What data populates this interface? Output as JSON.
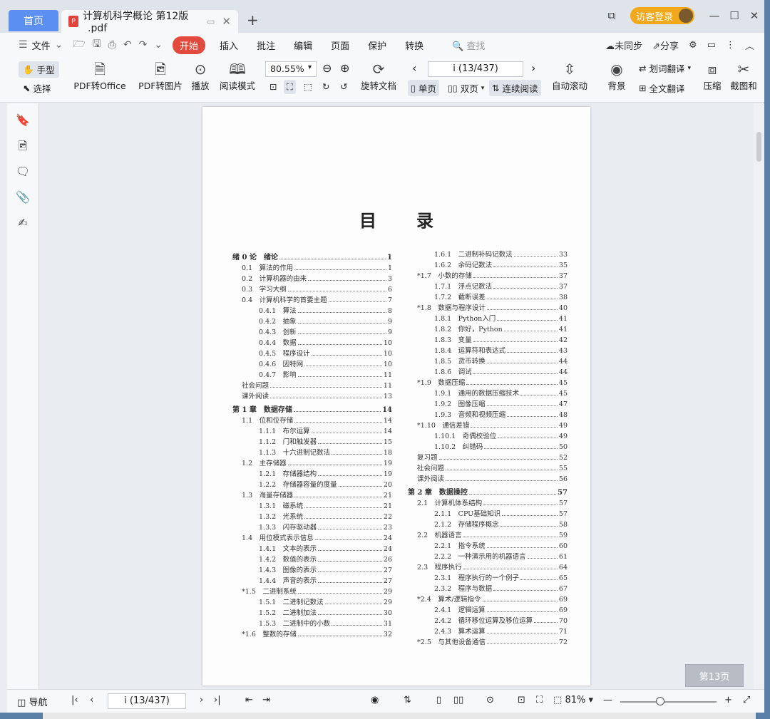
{
  "tabs": {
    "home": "首页",
    "doc": "计算机科学概论 第12版_.pdf",
    "add": "+"
  },
  "window": {
    "login": "访客登录",
    "min": "—",
    "max": "☐",
    "close": "✕",
    "layout_icon": "⧉"
  },
  "menu": {
    "file": "文件",
    "start": "开始",
    "items": [
      "插入",
      "批注",
      "编辑",
      "页面",
      "保护",
      "转换"
    ],
    "search": "查找",
    "sync": "未同步",
    "share": "分享"
  },
  "toolbar": {
    "hand": "手型",
    "select": "选择",
    "pdf_office": "PDF转Office",
    "pdf_img": "PDF转图片",
    "play": "播放",
    "read_mode": "阅读模式",
    "zoom": "80.55%",
    "rotate": "旋转文档",
    "page": "i (13/437)",
    "single": "单页",
    "double": "双页",
    "continuous": "连续阅读",
    "autoscroll": "自动滚动",
    "background": "背景",
    "word_trans": "划词翻译",
    "full_trans": "全文翻译",
    "compress": "压缩",
    "screenshot": "截图和"
  },
  "document": {
    "toc_title": "目录",
    "left": [
      {
        "n": "绪 0 论　绪论",
        "p": "1",
        "lv": "ch"
      },
      {
        "n": "0.1　算法的作用",
        "p": "1",
        "lv": "l1"
      },
      {
        "n": "0.2　计算机器的由来",
        "p": "3",
        "lv": "l1"
      },
      {
        "n": "0.3　学习大纲",
        "p": "6",
        "lv": "l1"
      },
      {
        "n": "0.4　计算机科学的首要主题",
        "p": "7",
        "lv": "l1"
      },
      {
        "n": "0.4.1　算法",
        "p": "8",
        "lv": "l2"
      },
      {
        "n": "0.4.2　抽象",
        "p": "9",
        "lv": "l2"
      },
      {
        "n": "0.4.3　创新",
        "p": "9",
        "lv": "l2"
      },
      {
        "n": "0.4.4　数据",
        "p": "10",
        "lv": "l2"
      },
      {
        "n": "0.4.5　程序设计",
        "p": "10",
        "lv": "l2"
      },
      {
        "n": "0.4.6　因特网",
        "p": "10",
        "lv": "l2"
      },
      {
        "n": "0.4.7　影响",
        "p": "11",
        "lv": "l2"
      },
      {
        "n": "社会问题",
        "p": "11",
        "lv": "l0s"
      },
      {
        "n": "课外阅读",
        "p": "13",
        "lv": "l0s"
      },
      {
        "n": "第 1 章　数据存储",
        "p": "14",
        "lv": "ch"
      },
      {
        "n": "1.1　位和位存储",
        "p": "14",
        "lv": "l1"
      },
      {
        "n": "1.1.1　布尔运算",
        "p": "14",
        "lv": "l2"
      },
      {
        "n": "1.1.2　门和触发器",
        "p": "15",
        "lv": "l2"
      },
      {
        "n": "1.1.3　十六进制记数法",
        "p": "18",
        "lv": "l2"
      },
      {
        "n": "1.2　主存储器",
        "p": "19",
        "lv": "l1"
      },
      {
        "n": "1.2.1　存储器结构",
        "p": "19",
        "lv": "l2"
      },
      {
        "n": "1.2.2　存储器容量的度量",
        "p": "20",
        "lv": "l2"
      },
      {
        "n": "1.3　海量存储器",
        "p": "21",
        "lv": "l1"
      },
      {
        "n": "1.3.1　磁系统",
        "p": "21",
        "lv": "l2"
      },
      {
        "n": "1.3.2　光系统",
        "p": "22",
        "lv": "l2"
      },
      {
        "n": "1.3.3　闪存驱动器",
        "p": "23",
        "lv": "l2"
      },
      {
        "n": "1.4　用位模式表示信息",
        "p": "24",
        "lv": "l1"
      },
      {
        "n": "1.4.1　文本的表示",
        "p": "24",
        "lv": "l2"
      },
      {
        "n": "1.4.2　数值的表示",
        "p": "26",
        "lv": "l2"
      },
      {
        "n": "1.4.3　图像的表示",
        "p": "27",
        "lv": "l2"
      },
      {
        "n": "1.4.4　声音的表示",
        "p": "27",
        "lv": "l2"
      },
      {
        "n": "*1.5　二进制系统",
        "p": "29",
        "lv": "l1"
      },
      {
        "n": "1.5.1　二进制记数法",
        "p": "29",
        "lv": "l2"
      },
      {
        "n": "1.5.2　二进制加法",
        "p": "30",
        "lv": "l2"
      },
      {
        "n": "1.5.3　二进制中的小数",
        "p": "31",
        "lv": "l2"
      },
      {
        "n": "*1.6　整数的存储",
        "p": "32",
        "lv": "l1"
      }
    ],
    "right": [
      {
        "n": "1.6.1　二进制补码记数法",
        "p": "33",
        "lv": "l2"
      },
      {
        "n": "1.6.2　余码记数法",
        "p": "35",
        "lv": "l2"
      },
      {
        "n": "*1.7　小数的存储",
        "p": "37",
        "lv": "l1"
      },
      {
        "n": "1.7.1　浮点记数法",
        "p": "37",
        "lv": "l2"
      },
      {
        "n": "1.7.2　截断误差",
        "p": "38",
        "lv": "l2"
      },
      {
        "n": "*1.8　数据与程序设计",
        "p": "40",
        "lv": "l1"
      },
      {
        "n": "1.8.1　Python入门",
        "p": "41",
        "lv": "l2"
      },
      {
        "n": "1.8.2　你好，Python",
        "p": "41",
        "lv": "l2"
      },
      {
        "n": "1.8.3　变量",
        "p": "42",
        "lv": "l2"
      },
      {
        "n": "1.8.4　运算符和表达式",
        "p": "43",
        "lv": "l2"
      },
      {
        "n": "1.8.5　货币转换",
        "p": "44",
        "lv": "l2"
      },
      {
        "n": "1.8.6　调试",
        "p": "44",
        "lv": "l2"
      },
      {
        "n": "*1.9　数据压缩",
        "p": "45",
        "lv": "l1"
      },
      {
        "n": "1.9.1　通用的数据压缩技术",
        "p": "45",
        "lv": "l2"
      },
      {
        "n": "1.9.2　图像压缩",
        "p": "47",
        "lv": "l2"
      },
      {
        "n": "1.9.3　音频和视频压缩",
        "p": "48",
        "lv": "l2"
      },
      {
        "n": "*1.10　通信差错",
        "p": "49",
        "lv": "l1"
      },
      {
        "n": "1.10.1　奇偶校验位",
        "p": "49",
        "lv": "l2"
      },
      {
        "n": "1.10.2　纠错码",
        "p": "50",
        "lv": "l2"
      },
      {
        "n": "复习题",
        "p": "52",
        "lv": "l0s"
      },
      {
        "n": "社会问题",
        "p": "55",
        "lv": "l0s"
      },
      {
        "n": "课外阅读",
        "p": "56",
        "lv": "l0s"
      },
      {
        "n": "第 2 章　数据操控",
        "p": "57",
        "lv": "ch"
      },
      {
        "n": "2.1　计算机体系结构",
        "p": "57",
        "lv": "l1"
      },
      {
        "n": "2.1.1　CPU基础知识",
        "p": "57",
        "lv": "l2"
      },
      {
        "n": "2.1.2　存储程序概念",
        "p": "58",
        "lv": "l2"
      },
      {
        "n": "2.2　机器语言",
        "p": "59",
        "lv": "l1"
      },
      {
        "n": "2.2.1　指令系统",
        "p": "60",
        "lv": "l2"
      },
      {
        "n": "2.2.2　一种演示用的机器语言",
        "p": "61",
        "lv": "l2"
      },
      {
        "n": "2.3　程序执行",
        "p": "64",
        "lv": "l1"
      },
      {
        "n": "2.3.1　程序执行的一个例子",
        "p": "65",
        "lv": "l2"
      },
      {
        "n": "2.3.2　程序与数据",
        "p": "67",
        "lv": "l2"
      },
      {
        "n": "*2.4　算术/逻辑指令",
        "p": "69",
        "lv": "l1"
      },
      {
        "n": "2.4.1　逻辑运算",
        "p": "69",
        "lv": "l2"
      },
      {
        "n": "2.4.2　循环移位运算及移位运算",
        "p": "70",
        "lv": "l2"
      },
      {
        "n": "2.4.3　算术运算",
        "p": "71",
        "lv": "l2"
      },
      {
        "n": "*2.5　与其他设备通信",
        "p": "72",
        "lv": "l1"
      }
    ]
  },
  "page_badge": "第13页",
  "status": {
    "nav": "导航",
    "page": "i (13/437)",
    "zoom": "81%"
  }
}
